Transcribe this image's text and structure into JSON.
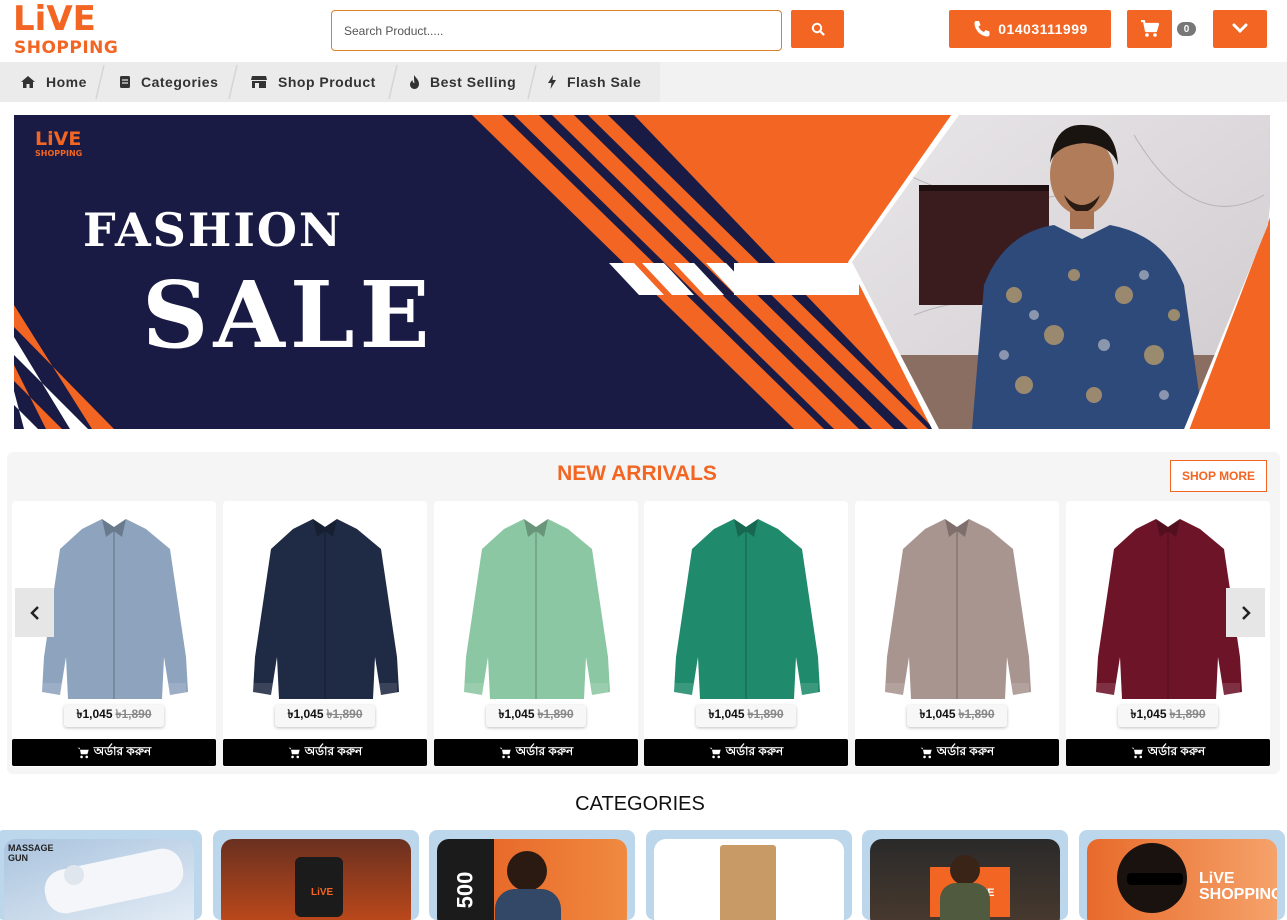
{
  "header": {
    "logo_line1": "LiVE",
    "logo_line2": "SHOPPING",
    "search_placeholder": "Search Product.....",
    "phone": "01403111999",
    "cart_count": "0",
    "accent_color": "#f26522"
  },
  "nav": {
    "items": [
      {
        "label": "Home",
        "icon": "home-icon"
      },
      {
        "label": "Categories",
        "icon": "list-icon"
      },
      {
        "label": "Shop Product",
        "icon": "store-icon"
      },
      {
        "label": "Best Selling",
        "icon": "fire-icon"
      },
      {
        "label": "Flash Sale",
        "icon": "bolt-icon"
      }
    ]
  },
  "banner": {
    "logo_line1": "LiVE",
    "logo_line2": "SHOPPING",
    "headline_small": "FASHION",
    "headline_large": "SALE"
  },
  "new_arrivals": {
    "title": "NEW ARRIVALS",
    "shop_more": "SHOP MORE",
    "products": [
      {
        "price": "৳1,045",
        "old_price": "৳1,890",
        "order_label": "অর্ডার করুন",
        "color": "#8ea3bd"
      },
      {
        "price": "৳1,045",
        "old_price": "৳1,890",
        "order_label": "অর্ডার করুন",
        "color": "#1f2a44"
      },
      {
        "price": "৳1,045",
        "old_price": "৳1,890",
        "order_label": "অর্ডার করুন",
        "color": "#8cc7a3"
      },
      {
        "price": "৳1,045",
        "old_price": "৳1,890",
        "order_label": "অর্ডার করুন",
        "color": "#1f8a6c"
      },
      {
        "price": "৳1,045",
        "old_price": "৳1,890",
        "order_label": "অর্ডার করুন",
        "color": "#a89590"
      },
      {
        "price": "৳1,045",
        "old_price": "৳1,890",
        "order_label": "অর্ডার করুন",
        "color": "#6e1428"
      }
    ]
  },
  "categories": {
    "title": "CATEGORIES",
    "items": [
      {
        "caption_line1": "MASSAGE",
        "caption_line2": "GUN"
      },
      {
        "caption": "LiVE"
      },
      {
        "caption": "500"
      },
      {
        "caption": ""
      },
      {
        "caption": "LiVE"
      },
      {
        "caption": "LiVE SHOPPING"
      }
    ]
  }
}
